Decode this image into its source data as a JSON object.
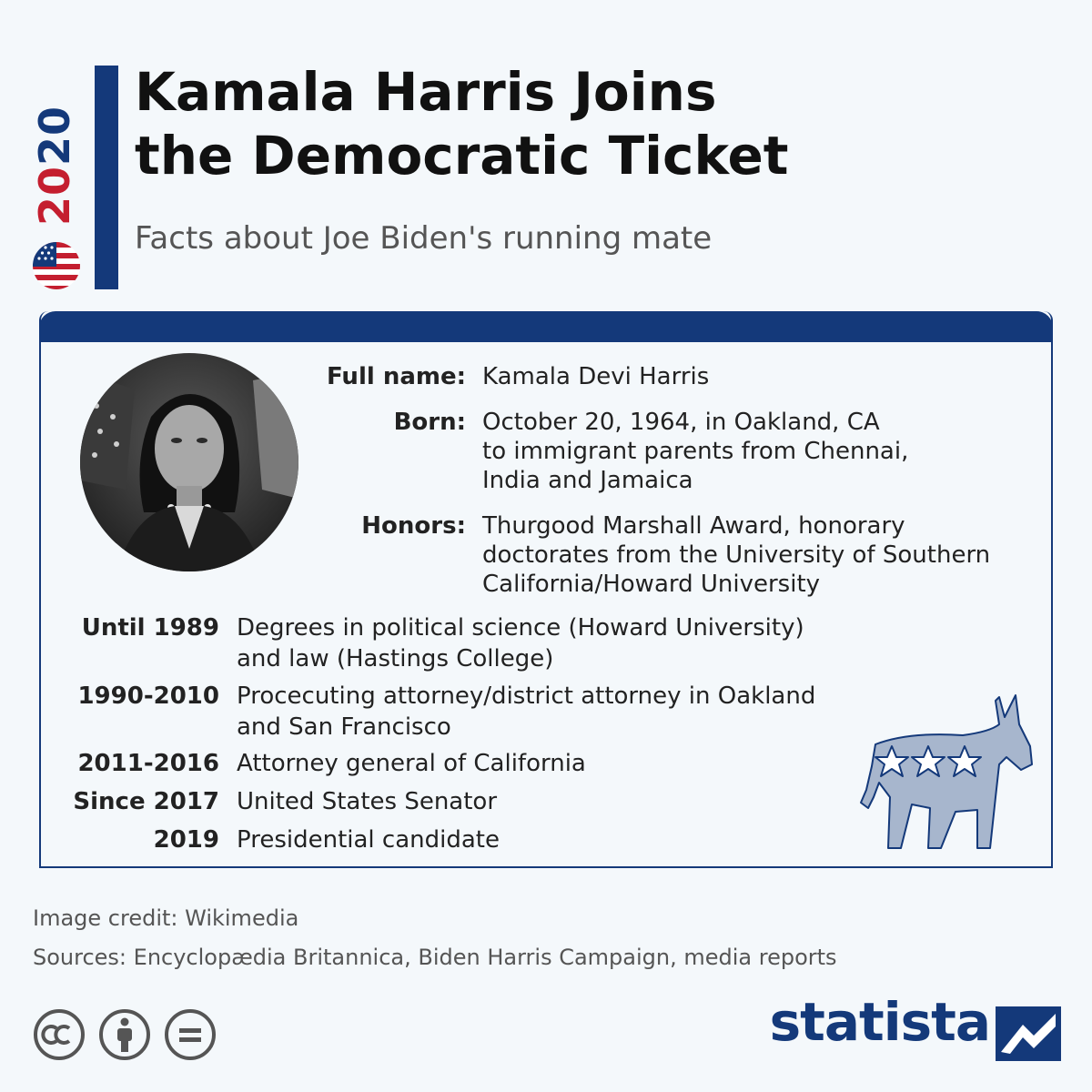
{
  "header": {
    "year_a": "20",
    "year_b": "20",
    "title": "Kamala Harris Joins\nthe Democratic Ticket",
    "subtitle": "Facts about Joe Biden's running mate"
  },
  "facts": [
    {
      "label": "Full name:",
      "value": "Kamala Devi Harris"
    },
    {
      "label": "Born:",
      "value": "October 20, 1964, in Oakland, CA\nto immigrant parents from Chennai,\nIndia and Jamaica"
    },
    {
      "label": "Honors:",
      "value": "Thurgood Marshall Award, honorary\ndoctorates from the University of Southern\nCalifornia/Howard University"
    }
  ],
  "timeline": [
    {
      "year": "Until 1989",
      "desc": "Degrees in political science (Howard University)\nand law (Hastings College)"
    },
    {
      "year": "1990-2010",
      "desc": "Procecuting attorney/district attorney in Oakland\nand San Francisco"
    },
    {
      "year": "2011-2016",
      "desc": "Attorney general of California"
    },
    {
      "year": "Since 2017",
      "desc": "United States Senator"
    },
    {
      "year": "2019",
      "desc": "Presidential candidate"
    }
  ],
  "footer": {
    "credit": "Image credit: Wikimedia",
    "sources": "Sources: Encyclopædia Britannica, Biden Harris Campaign, media reports",
    "brand": "statista"
  },
  "icons": {
    "flag": "us-flag-icon",
    "portrait": "portrait-photo",
    "donkey": "democratic-donkey-icon",
    "cc": [
      "cc-icon",
      "attribution-icon",
      "no-derivatives-icon"
    ],
    "brand_logo": "statista-logo-icon"
  },
  "colors": {
    "navy": "#14397a",
    "red": "#c41e2f",
    "background": "#f4f8fb"
  }
}
